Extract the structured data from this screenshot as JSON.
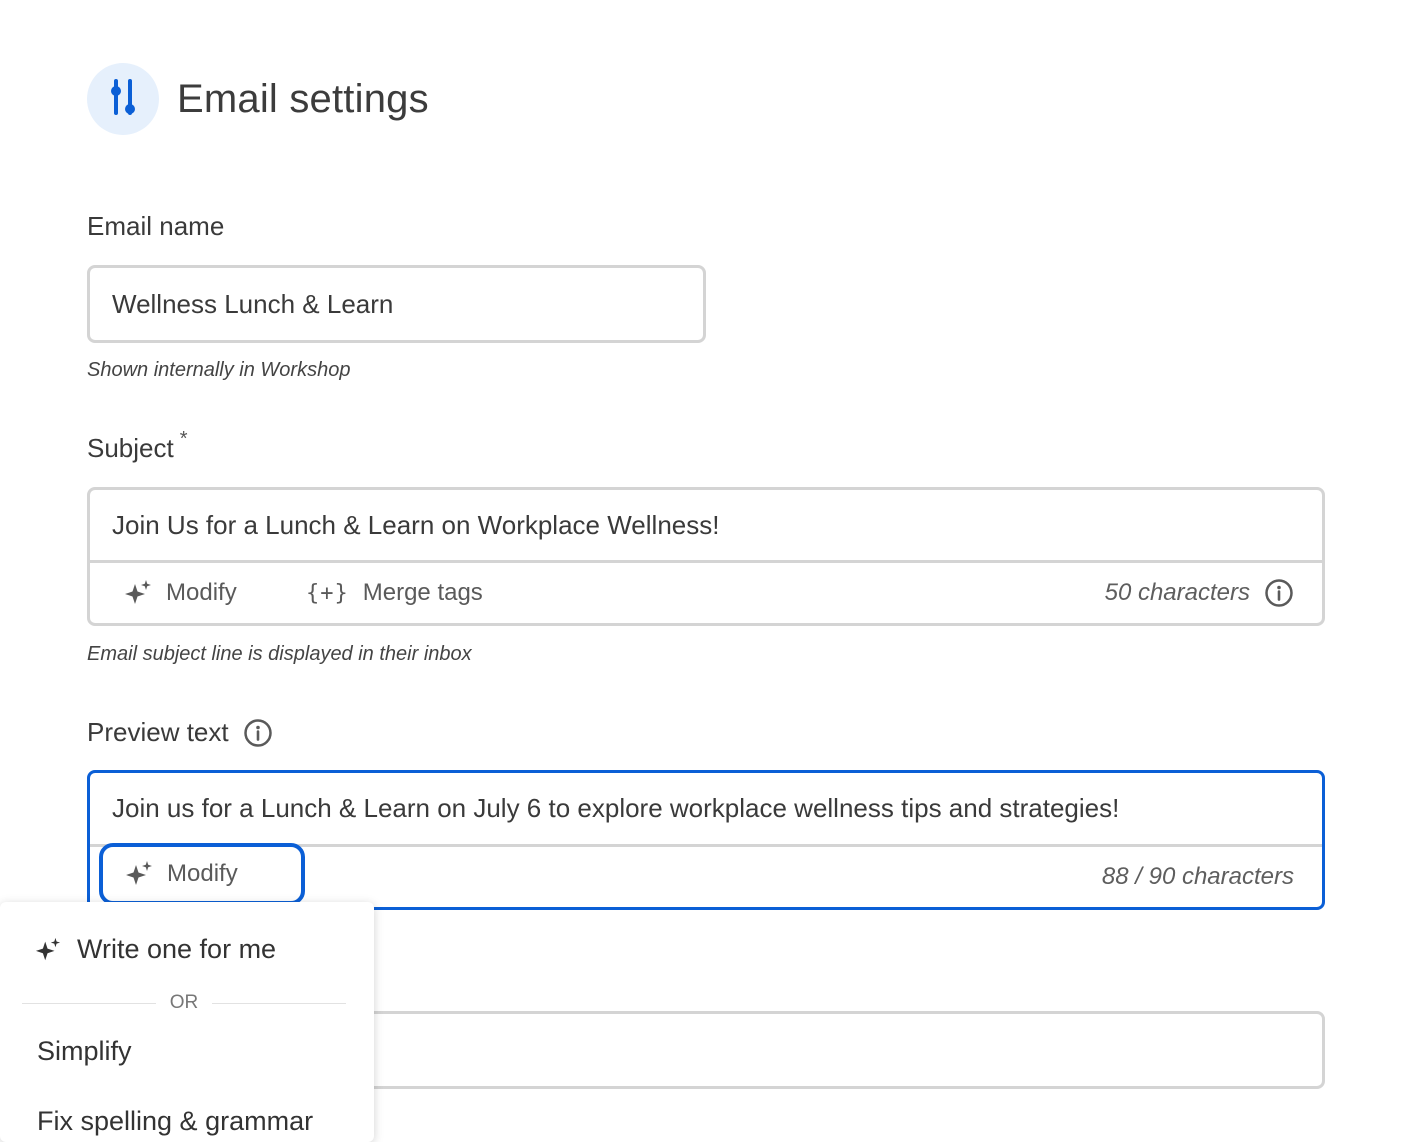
{
  "header": {
    "title": "Email settings",
    "icon": "sliders-icon",
    "accent_color": "#0b5fd6",
    "icon_bg": "#e6f0fc"
  },
  "email_name": {
    "label": "Email name",
    "value": "Wellness Lunch & Learn",
    "hint": "Shown internally in Workshop"
  },
  "subject": {
    "label": "Subject",
    "required_marker": "*",
    "value": "Join Us for a Lunch & Learn on Workplace Wellness!",
    "modify_label": "Modify",
    "merge_glyph": "{+}",
    "merge_label": "Merge tags",
    "char_count": "50 characters",
    "hint": "Email subject line is displayed in their inbox"
  },
  "preview_text": {
    "label": "Preview text",
    "value": "Join us for a Lunch & Learn on July 6 to explore workplace wellness tips and strategies!",
    "modify_label": "Modify",
    "char_count": "88 / 90 characters"
  },
  "modify_menu": {
    "write_label": "Write one for me",
    "or_label": "OR",
    "items": [
      "Simplify",
      "Fix spelling & grammar"
    ]
  }
}
